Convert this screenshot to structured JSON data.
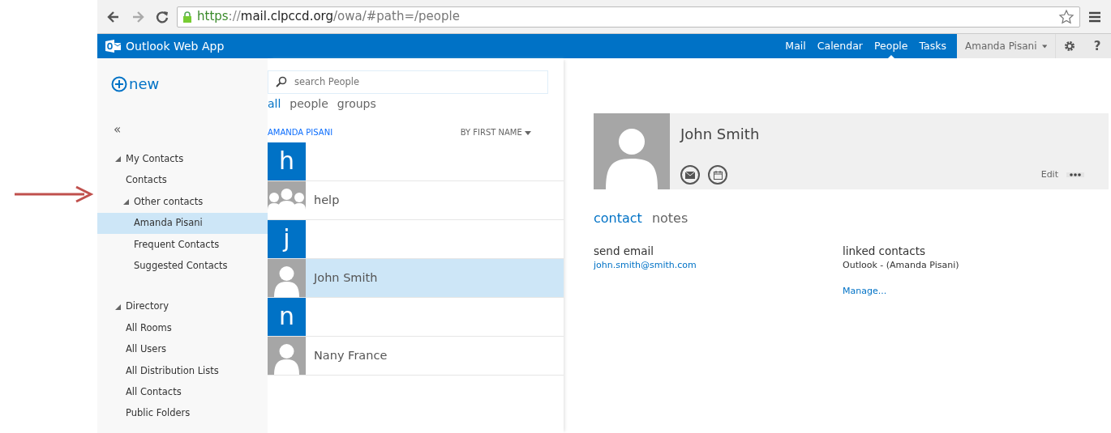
{
  "browser": {
    "url": {
      "scheme": "https",
      "separator": "://",
      "host": "mail.clpccd.org",
      "path": "/owa/#path=/people"
    }
  },
  "app_bar": {
    "title": "Outlook Web App",
    "nav": [
      {
        "label": "Mail",
        "selected": false
      },
      {
        "label": "Calendar",
        "selected": false
      },
      {
        "label": "People",
        "selected": true
      },
      {
        "label": "Tasks",
        "selected": false
      }
    ],
    "user": "Amanda Pisani",
    "help": "?"
  },
  "new_button": "new",
  "search": {
    "placeholder": "search People"
  },
  "filters": [
    {
      "label": "all",
      "selected": true
    },
    {
      "label": "people",
      "selected": false
    },
    {
      "label": "groups",
      "selected": false
    }
  ],
  "collapse": "«",
  "sidebar": [
    {
      "label": "My Contacts",
      "expanded": true,
      "selected": false,
      "children": [
        {
          "label": "Contacts",
          "selected": false
        },
        {
          "label": "Other contacts",
          "expanded": true,
          "selected": false,
          "children": [
            {
              "label": "Amanda Pisani",
              "selected": true
            },
            {
              "label": "Frequent Contacts",
              "selected": false
            },
            {
              "label": "Suggested Contacts",
              "selected": false
            }
          ]
        }
      ]
    },
    {
      "label": "Directory",
      "expanded": true,
      "selected": false,
      "children": [
        {
          "label": "All Rooms",
          "selected": false
        },
        {
          "label": "All Users",
          "selected": false
        },
        {
          "label": "All Distribution Lists",
          "selected": false
        },
        {
          "label": "All Contacts",
          "selected": false
        },
        {
          "label": "Public Folders",
          "selected": false
        }
      ]
    }
  ],
  "list": {
    "folder": "AMANDA PISANI",
    "sort": "BY FIRST NAME",
    "items": [
      {
        "kind": "letter",
        "text": "h"
      },
      {
        "kind": "group",
        "name": "help",
        "selected": false
      },
      {
        "kind": "letter",
        "text": "j"
      },
      {
        "kind": "person",
        "name": "John Smith",
        "selected": true
      },
      {
        "kind": "letter",
        "text": "n"
      },
      {
        "kind": "person",
        "name": "Nany France",
        "selected": false
      }
    ]
  },
  "detail": {
    "name": "John Smith",
    "edit": "Edit",
    "tabs": [
      {
        "label": "contact",
        "selected": true
      },
      {
        "label": "notes",
        "selected": false
      }
    ],
    "fields": [
      {
        "label": "send email",
        "value": "john.smith@smith.com",
        "kind": "link"
      },
      {
        "label": "linked contacts",
        "value": "Outlook - (Amanda Pisani)",
        "kind": "text",
        "action": "Manage..."
      }
    ]
  }
}
